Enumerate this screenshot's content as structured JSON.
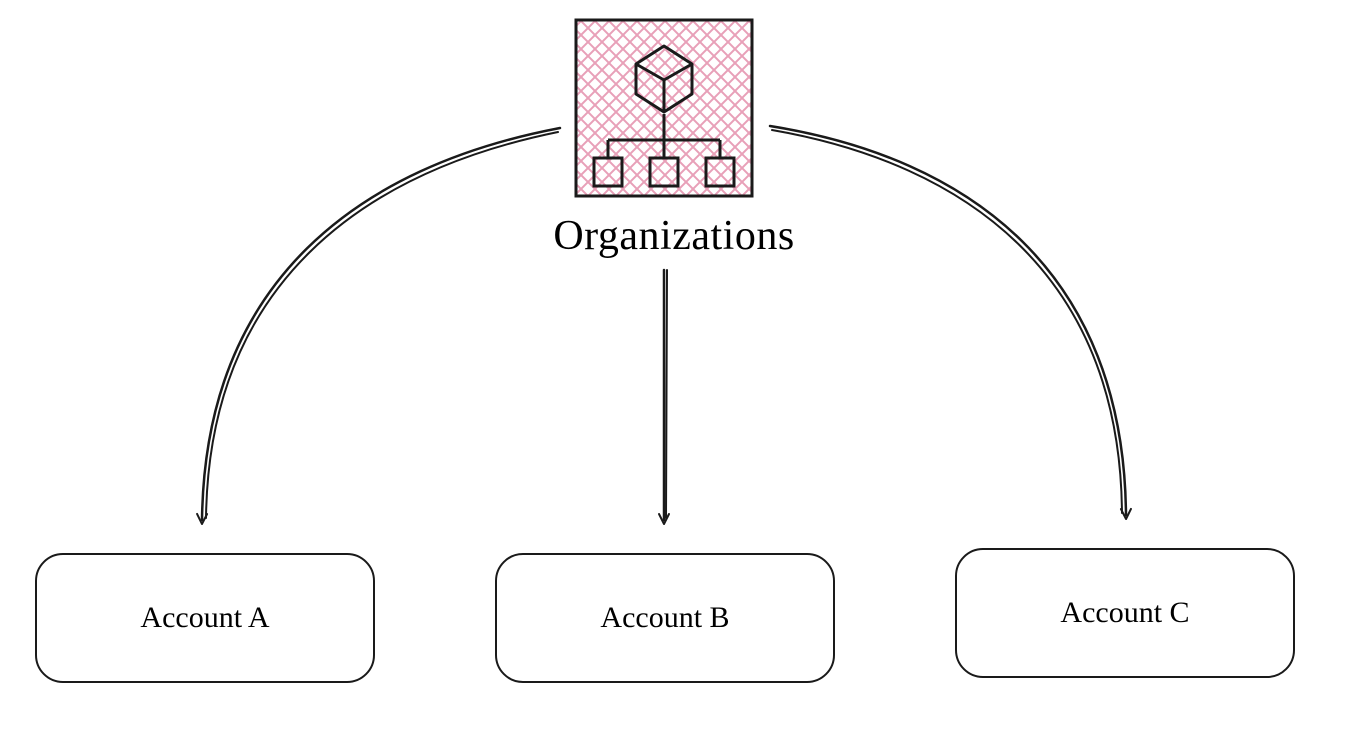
{
  "root": {
    "label": "Organizations",
    "icon": "organizations-hierarchy-icon"
  },
  "accounts": [
    {
      "label": "Account A"
    },
    {
      "label": "Account B"
    },
    {
      "label": "Account C"
    }
  ]
}
